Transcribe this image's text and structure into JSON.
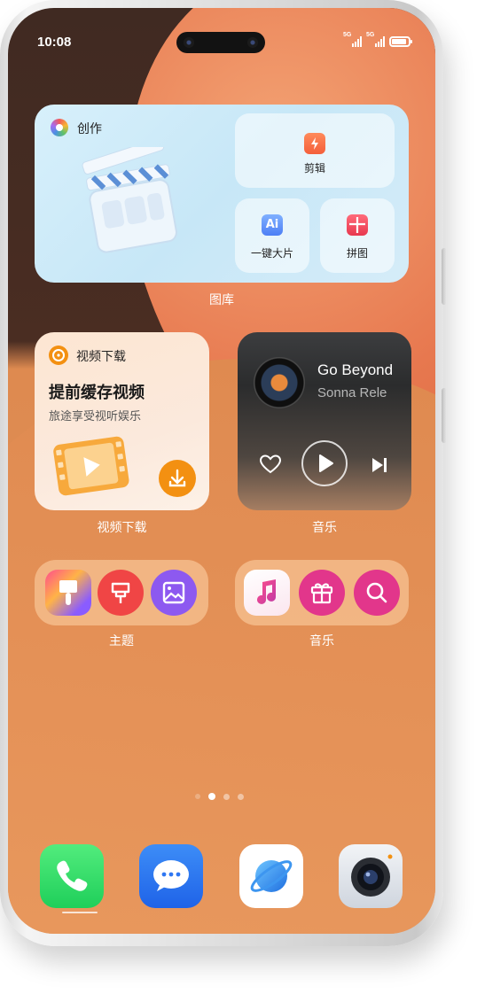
{
  "status_bar": {
    "time": "10:08",
    "network1": "5G",
    "network2": "5G",
    "battery_fraction": 0.9
  },
  "creation_widget": {
    "title": "创作",
    "edit_label": "剪辑",
    "oneclick_label": "一键大片",
    "oneclick_icon_text": "Ai",
    "collage_label": "拼图",
    "caption": "图库"
  },
  "video_widget": {
    "title": "视频下载",
    "headline": "提前缓存视频",
    "subtitle": "旅途享受视听娱乐",
    "caption": "视频下载"
  },
  "music_widget": {
    "song": "Go Beyond",
    "artist": "Sonna Rele",
    "caption": "音乐"
  },
  "theme_widget": {
    "caption": "主题",
    "icons": [
      "paintbrush-icon",
      "stamp-brush-icon",
      "image-icon"
    ]
  },
  "music_shortcuts": {
    "caption": "音乐",
    "icons": [
      "music-note-icon",
      "gift-icon",
      "search-icon"
    ]
  },
  "page_indicator": {
    "pages": 4,
    "current": 2
  },
  "dock": {
    "apps": [
      "phone-icon",
      "messages-icon",
      "browser-icon",
      "camera-icon"
    ]
  },
  "colors": {
    "accent_orange": "#f39011",
    "theme_pink": "#e2368b",
    "phone_green": "#2fdc6a",
    "messages_blue": "#2f77f2"
  }
}
